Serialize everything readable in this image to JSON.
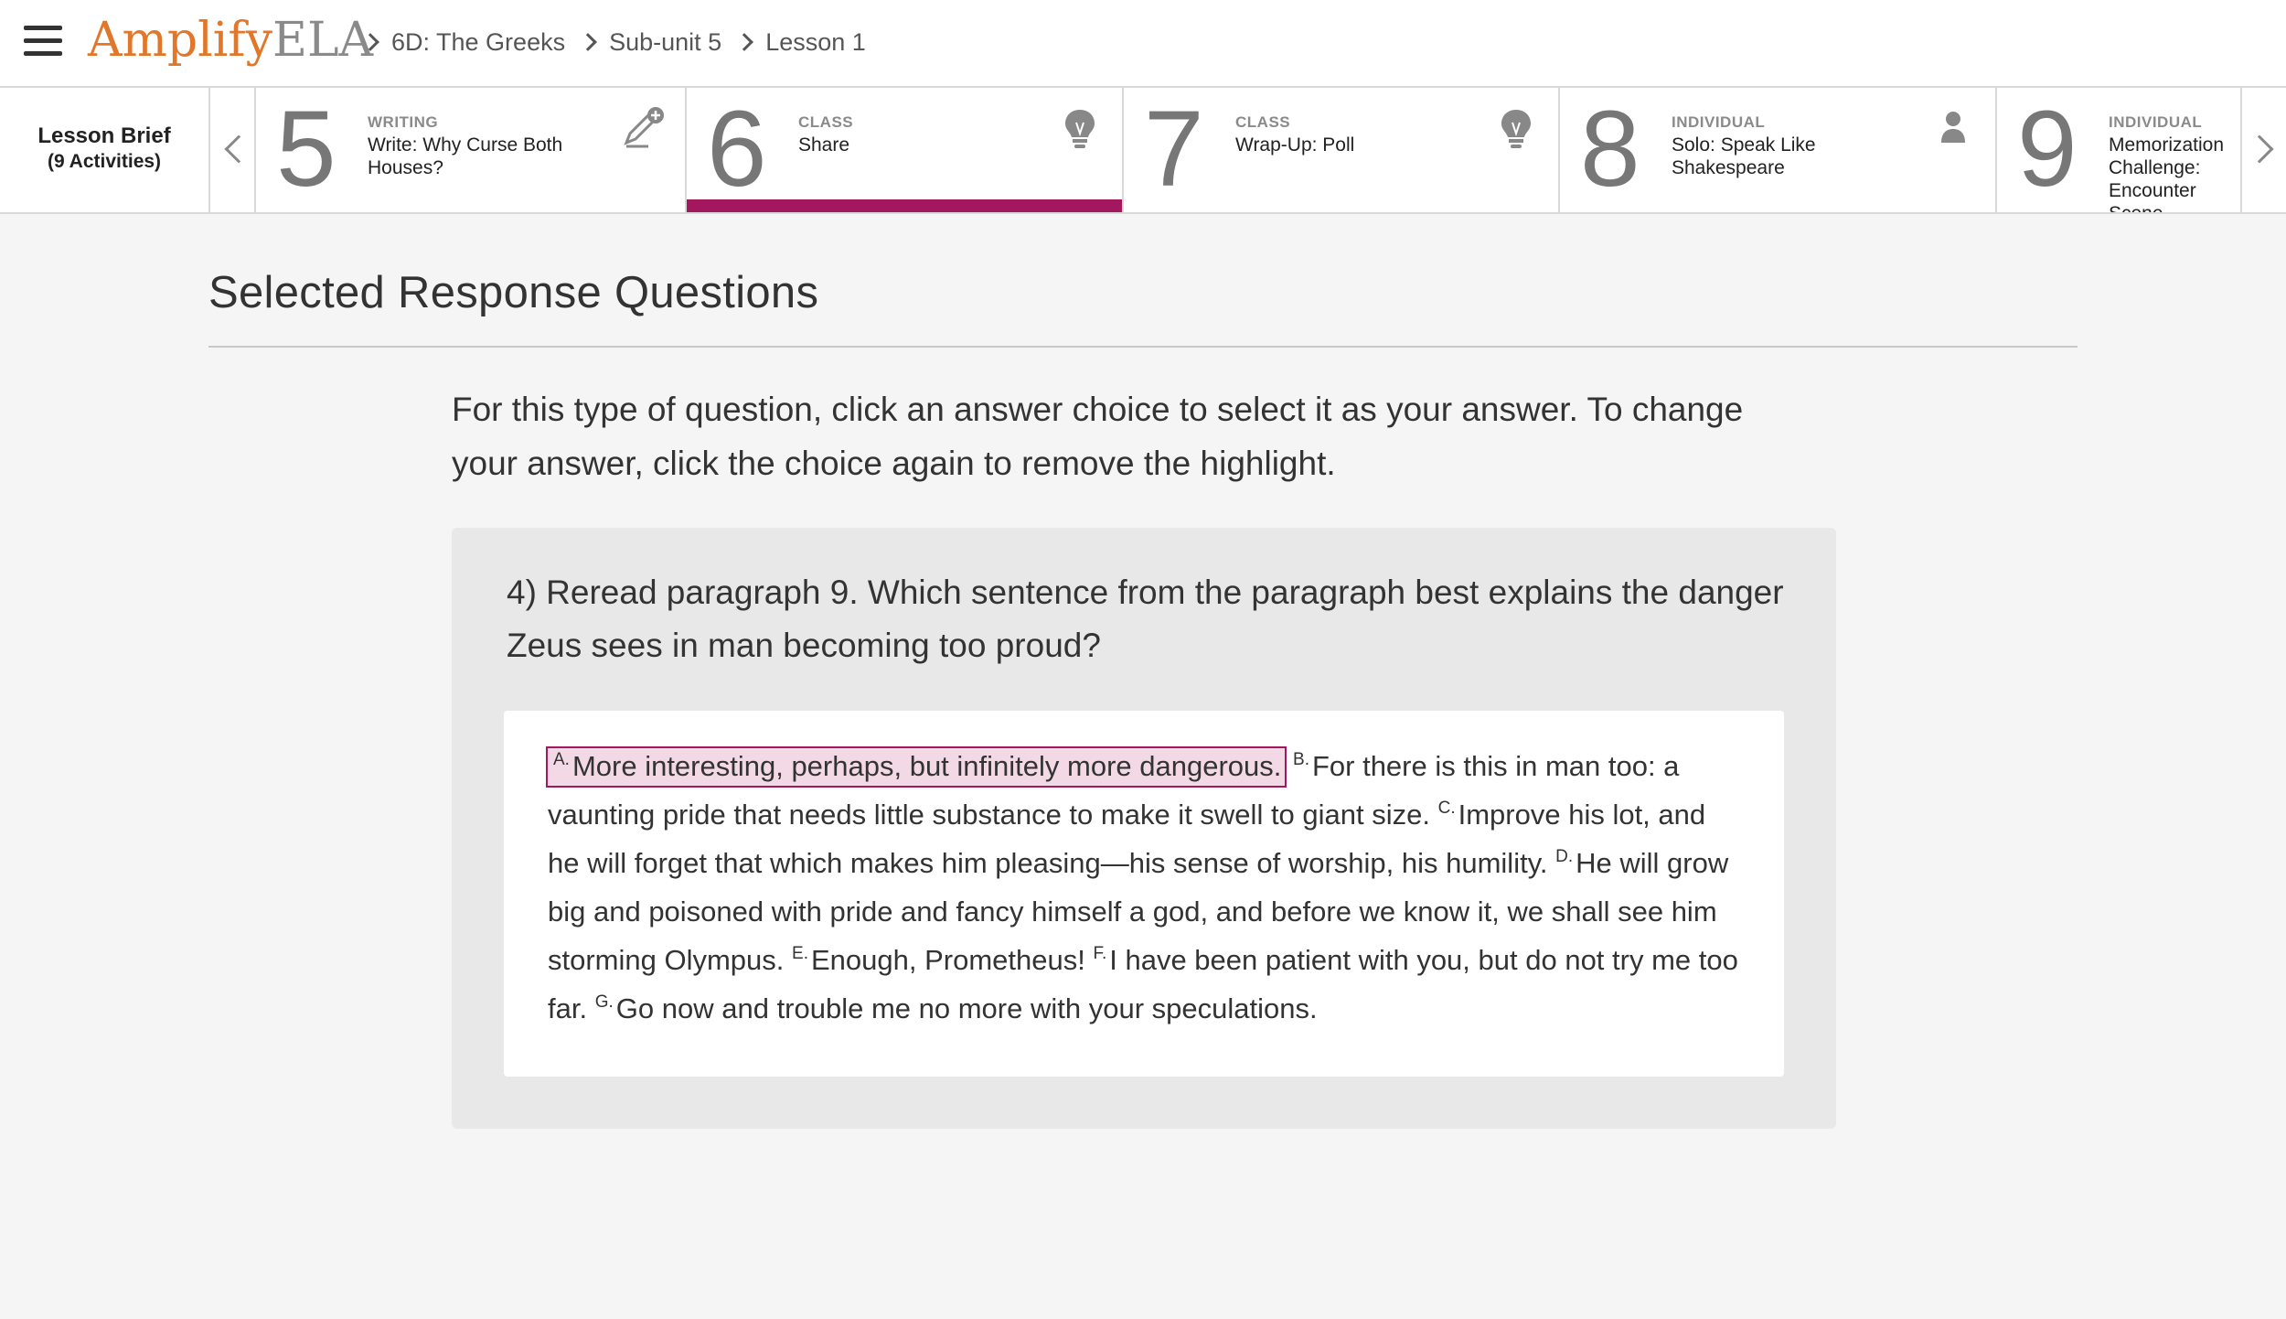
{
  "header": {
    "logo_brand": "Amplify",
    "logo_product": "ELA",
    "breadcrumbs": [
      "6D: The Greeks",
      "Sub-unit 5",
      "Lesson 1"
    ]
  },
  "lesson_brief": {
    "title": "Lesson Brief",
    "subtitle": "(9 Activities)"
  },
  "activities": [
    {
      "number": "5",
      "category": "WRITING",
      "title": "Write: Why Curse Both Houses?",
      "icon": "pencil-plus-icon",
      "active": false
    },
    {
      "number": "6",
      "category": "CLASS",
      "title": "Share",
      "icon": "lightbulb-icon",
      "active": true
    },
    {
      "number": "7",
      "category": "CLASS",
      "title": "Wrap-Up: Poll",
      "icon": "lightbulb-icon",
      "active": false
    },
    {
      "number": "8",
      "category": "INDIVIDUAL",
      "title": "Solo: Speak Like Shakespeare",
      "icon": "person-icon",
      "active": false
    },
    {
      "number": "9",
      "category": "INDIVIDUAL",
      "title": "Memorization Challenge: Encounter Scene",
      "icon": "person-icon",
      "active": false
    }
  ],
  "main": {
    "section_title": "Selected Response Questions",
    "instructions": "For this type of question, click an answer choice to select it as your answer. To change your answer, click the choice again to remove the highlight.",
    "question": "4) Reread paragraph 9. Which sentence from the paragraph best explains the danger Zeus sees in man becoming too proud?",
    "choices": [
      {
        "letter": "A.",
        "text": "More interesting, perhaps, but infinitely more dangerous.",
        "selected": true
      },
      {
        "letter": "B.",
        "text": "For there is this in man too: a vaunting pride that needs little substance to make it swell to giant size.",
        "selected": false
      },
      {
        "letter": "C.",
        "text": "Improve his lot, and he will forget that which makes him pleasing—his sense of worship, his humility.",
        "selected": false
      },
      {
        "letter": "D.",
        "text": "He will grow big and poisoned with pride and fancy himself a god, and before we know it, we shall see him storming Olympus.",
        "selected": false
      },
      {
        "letter": "E.",
        "text": "Enough, Prometheus!",
        "selected": false
      },
      {
        "letter": "F.",
        "text": "I have been patient with you, but do not try me too far.",
        "selected": false
      },
      {
        "letter": "G.",
        "text": "Go now and trouble me no more with your speculations.",
        "selected": false
      }
    ]
  },
  "colors": {
    "brand_orange": "#e0772a",
    "accent_magenta": "#a3175e",
    "selected_fill": "#f3d9e6"
  }
}
